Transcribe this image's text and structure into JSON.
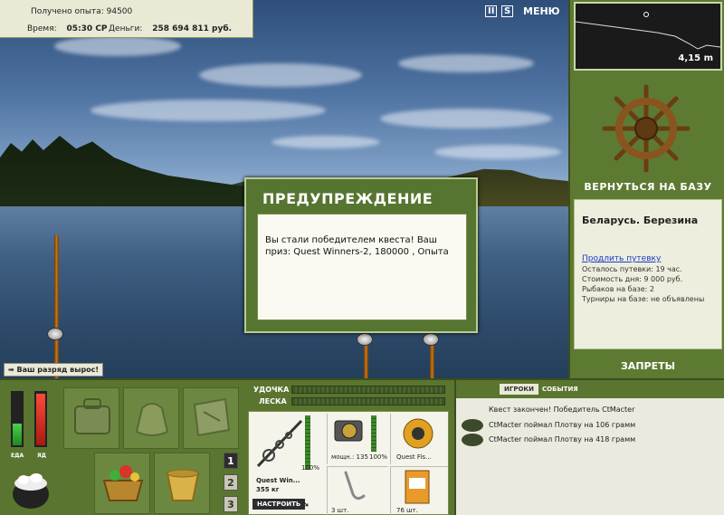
{
  "info": {
    "exp_label": "Получено опыта:",
    "exp_value": "94500",
    "time_label": "Время:",
    "time_value": "05:30 СР",
    "money_label": "Деньги:",
    "money_value": "258 694 811 руб."
  },
  "top_icons": {
    "pause": "II",
    "sound": "S",
    "menu": "МЕНЮ"
  },
  "depth": {
    "value": "4,15 m"
  },
  "sidebar": {
    "back_to_base": "ВЕРНУТЬСЯ НА БАЗУ",
    "location": "Беларусь. Березина",
    "extend_link": "Продлить путевку",
    "lines": [
      "Осталось путевки: 19 час.",
      "Стоимость дня: 9 000 руб.",
      "Рыбаков на базе: 2",
      "Турниры на базе: не объявлены"
    ],
    "bans": "ЗАПРЕТЫ"
  },
  "dialog": {
    "title": "ПРЕДУПРЕЖДЕНИЕ",
    "message": "Вы стали победителем квеста! Ваш приз: Quest Winners-2, 180000 , Опыта"
  },
  "rank_notice": "Ваш разряд вырос!",
  "meters": {
    "food_label": "ЕДА",
    "poison_label": "ЯД"
  },
  "slots": {
    "numbers": [
      "1",
      "2",
      "3"
    ]
  },
  "gauges": {
    "rod_label": "УДОЧКА",
    "line_label": "ЛЕСКА"
  },
  "tackle": {
    "rod_name": "Quest Win...",
    "rod_weight": "355 кг",
    "rod_pct": "100%",
    "reel_power": "мощн.: 135",
    "reel_pct": "100%",
    "line_name": "Quest Fis...",
    "hook_count": "3 шт.",
    "bait_count": "76 шт.",
    "setup_button": "НАСТРОИТЬ"
  },
  "events": {
    "tabs": [
      "ИГРОКИ",
      "СОБЫТИЯ"
    ],
    "items": [
      "Квест закончен! Победитель CtMacter",
      "CtMacter поймал Плотву на 106 грамм",
      "CtMacter поймал Плотву на 418 грамм"
    ]
  },
  "colors": {
    "panel_green": "#5a7530",
    "accent_link": "#1a3cc9"
  }
}
